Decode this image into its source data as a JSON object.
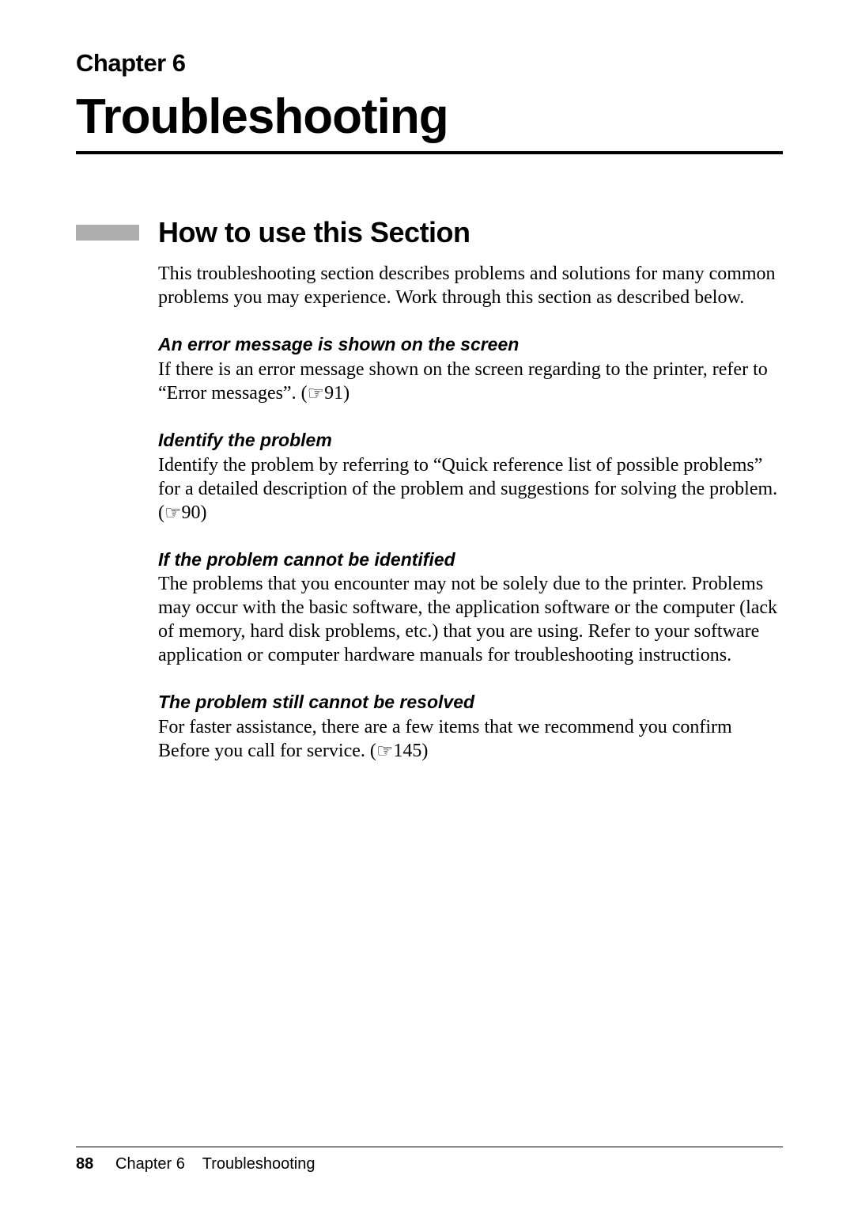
{
  "chapter": {
    "label": "Chapter 6",
    "title": "Troubleshooting"
  },
  "section": {
    "title": "How to use this Section",
    "intro": "This troubleshooting section describes problems and solutions for many common problems you may experience. Work through this section as described below."
  },
  "subsections": [
    {
      "heading": "An error message is shown on the screen",
      "body": "If there is an error message shown on the screen regarding to the printer, refer to “Error messages”. (",
      "ref": "91",
      "after": ")"
    },
    {
      "heading": "Identify the problem",
      "body": "Identify the problem by referring to “Quick reference list of possible problems” for a detailed description of the problem and suggestions for solving the problem. (",
      "ref": "90",
      "after": ")"
    },
    {
      "heading": "If the problem cannot be identified",
      "body": "The problems that you encounter may not be solely due to the printer. Problems may occur with the basic software, the application software or the computer (lack of memory, hard disk problems, etc.) that you are using.  Refer to your software application or computer hardware manuals for troubleshooting instructions.",
      "ref": "",
      "after": ""
    },
    {
      "heading": "The problem still cannot be resolved",
      "body": "For faster assistance, there are a few items that we recommend you confirm Before you call for service. (",
      "ref": "145",
      "after": ")"
    }
  ],
  "footer": {
    "page_number": "88",
    "chapter_ref": "Chapter 6",
    "chapter_title": "Troubleshooting"
  },
  "ref_symbol": "☞"
}
